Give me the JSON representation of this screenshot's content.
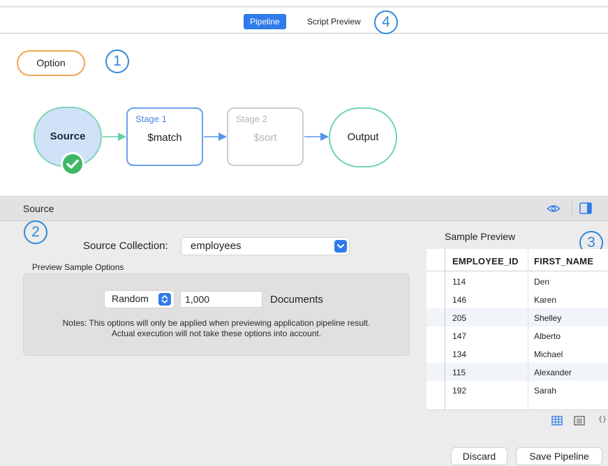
{
  "tabs": {
    "pipeline": "Pipeline",
    "script_preview": "Script Preview"
  },
  "annotations": {
    "a1": "1",
    "a2": "2",
    "a3": "3",
    "a4": "4"
  },
  "option_button": "Option",
  "pipeline": {
    "source": "Source",
    "stage1": {
      "label": "Stage 1",
      "op": "$match"
    },
    "stage2": {
      "label": "Stage 2",
      "op": "$sort"
    },
    "output": "Output"
  },
  "section": {
    "title": "Source"
  },
  "source_settings": {
    "collection_label": "Source Collection:",
    "collection_value": "employees",
    "preview_options_label": "Preview Sample Options",
    "sample_mode": "Random",
    "sample_count": "1,000",
    "documents_label": "Documents",
    "note_line1": "Notes: This options will only be applied when previewing application pipeline result.",
    "note_line2": "Actual execution will not take these options into account."
  },
  "sample_preview": {
    "title": "Sample Preview",
    "columns": [
      "EMPLOYEE_ID",
      "FIRST_NAME"
    ],
    "rows": [
      [
        "114",
        "Den"
      ],
      [
        "146",
        "Karen"
      ],
      [
        "205",
        "Shelley"
      ],
      [
        "147",
        "Alberto"
      ],
      [
        "134",
        "Michael"
      ],
      [
        "115",
        "Alexander"
      ],
      [
        "192",
        "Sarah"
      ]
    ],
    "json_icon_text": "{}"
  },
  "buttons": {
    "discard": "Discard",
    "save": "Save Pipeline"
  },
  "colors": {
    "accent": "#2f7bea",
    "annotation": "#2f88d8",
    "option_border": "#f0a54d",
    "node_green": "#6fd4b2",
    "check_green": "#3fb865",
    "source_fill": "#cfe2f8"
  },
  "icons": {
    "check": "checkmark-icon",
    "eye": "eye-icon",
    "panel": "panel-toggle-icon",
    "grid": "grid-view-icon",
    "list": "list-view-icon",
    "json": "json-view-icon"
  }
}
